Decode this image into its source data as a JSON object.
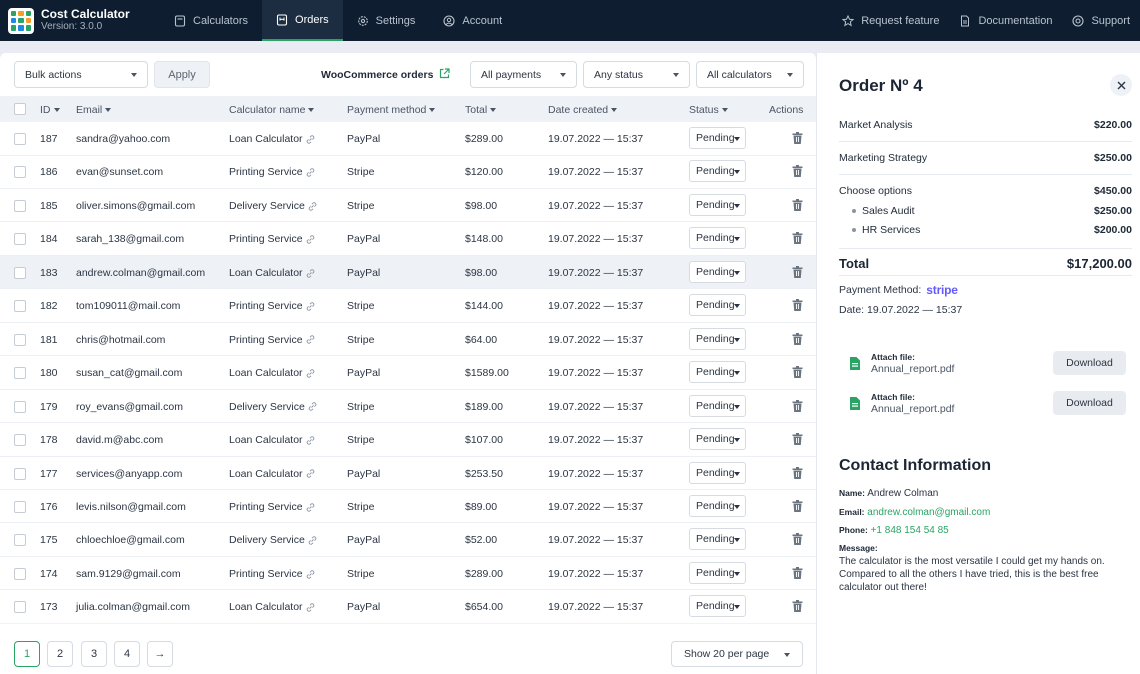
{
  "app": {
    "title": "Cost Calculator",
    "version": "Version: 3.0.0"
  },
  "nav": {
    "items": [
      {
        "label": "Calculators",
        "icon": "calculator-icon"
      },
      {
        "label": "Orders",
        "icon": "orders-icon",
        "active": true
      },
      {
        "label": "Settings",
        "icon": "gear-icon"
      },
      {
        "label": "Account",
        "icon": "user-circle-icon"
      }
    ],
    "right": [
      {
        "label": "Request feature",
        "icon": "star-icon"
      },
      {
        "label": "Documentation",
        "icon": "document-icon"
      },
      {
        "label": "Support",
        "icon": "lifebuoy-icon"
      }
    ]
  },
  "toolbar": {
    "bulk_actions": "Bulk actions",
    "apply": "Apply",
    "woo_link": "WooCommerce orders",
    "payments_filter": "All payments",
    "status_filter": "Any status",
    "calculators_filter": "All calculators"
  },
  "table": {
    "headers": {
      "id": "ID",
      "email": "Email",
      "calculator": "Calculator name",
      "payment": "Payment method",
      "total": "Total",
      "date": "Date created",
      "status": "Status",
      "actions": "Actions"
    },
    "rows": [
      {
        "id": "187",
        "email": "sandra@yahoo.com",
        "calculator": "Loan Calculator",
        "payment": "PayPal",
        "total": "$289.00",
        "date": "19.07.2022 — 15:37",
        "status": "Pending"
      },
      {
        "id": "186",
        "email": "evan@sunset.com",
        "calculator": "Printing Service",
        "payment": "Stripe",
        "total": "$120.00",
        "date": "19.07.2022 — 15:37",
        "status": "Pending"
      },
      {
        "id": "185",
        "email": "oliver.simons@gmail.com",
        "calculator": "Delivery Service",
        "payment": "Stripe",
        "total": "$98.00",
        "date": "19.07.2022 — 15:37",
        "status": "Pending"
      },
      {
        "id": "184",
        "email": "sarah_138@gmail.com",
        "calculator": "Printing Service",
        "payment": "PayPal",
        "total": "$148.00",
        "date": "19.07.2022 — 15:37",
        "status": "Pending"
      },
      {
        "id": "183",
        "email": "andrew.colman@gmail.com",
        "calculator": "Loan Calculator",
        "payment": "PayPal",
        "total": "$98.00",
        "date": "19.07.2022 — 15:37",
        "status": "Pending"
      },
      {
        "id": "182",
        "email": "tom109011@mail.com",
        "calculator": "Printing Service",
        "payment": "Stripe",
        "total": "$144.00",
        "date": "19.07.2022 — 15:37",
        "status": "Pending"
      },
      {
        "id": "181",
        "email": "chris@hotmail.com",
        "calculator": "Printing Service",
        "payment": "Stripe",
        "total": "$64.00",
        "date": "19.07.2022 — 15:37",
        "status": "Pending"
      },
      {
        "id": "180",
        "email": "susan_cat@gmail.com",
        "calculator": "Loan Calculator",
        "payment": "PayPal",
        "total": "$1589.00",
        "date": "19.07.2022 — 15:37",
        "status": "Pending"
      },
      {
        "id": "179",
        "email": "roy_evans@gmail.com",
        "calculator": "Delivery Service",
        "payment": "Stripe",
        "total": "$189.00",
        "date": "19.07.2022 — 15:37",
        "status": "Pending"
      },
      {
        "id": "178",
        "email": "david.m@abc.com",
        "calculator": "Loan Calculator",
        "payment": "Stripe",
        "total": "$107.00",
        "date": "19.07.2022 — 15:37",
        "status": "Pending"
      },
      {
        "id": "177",
        "email": "services@anyapp.com",
        "calculator": "Loan Calculator",
        "payment": "PayPal",
        "total": "$253.50",
        "date": "19.07.2022 — 15:37",
        "status": "Pending"
      },
      {
        "id": "176",
        "email": "levis.nilson@gmail.com",
        "calculator": "Printing Service",
        "payment": "Stripe",
        "total": "$89.00",
        "date": "19.07.2022 — 15:37",
        "status": "Pending"
      },
      {
        "id": "175",
        "email": "chloechloe@gmail.com",
        "calculator": "Delivery Service",
        "payment": "PayPal",
        "total": "$52.00",
        "date": "19.07.2022 — 15:37",
        "status": "Pending"
      },
      {
        "id": "174",
        "email": "sam.9129@gmail.com",
        "calculator": "Printing Service",
        "payment": "Stripe",
        "total": "$289.00",
        "date": "19.07.2022 — 15:37",
        "status": "Pending"
      },
      {
        "id": "173",
        "email": "julia.colman@gmail.com",
        "calculator": "Loan Calculator",
        "payment": "PayPal",
        "total": "$654.00",
        "date": "19.07.2022 — 15:37",
        "status": "Pending"
      }
    ]
  },
  "pagination": {
    "pages": [
      "1",
      "2",
      "3",
      "4"
    ],
    "next": "→",
    "per_page": "Show 20 per page"
  },
  "order": {
    "title": "Order Nº 4",
    "lines": [
      {
        "label": "Market Analysis",
        "value": "$220.00"
      },
      {
        "label": "Marketing Strategy",
        "value": "$250.00"
      },
      {
        "label": "Choose options",
        "value": "$450.00"
      }
    ],
    "sub_lines": [
      {
        "label": "Sales Audit",
        "value": "$250.00"
      },
      {
        "label": "HR Services",
        "value": "$200.00"
      }
    ],
    "total_label": "Total",
    "total_value": "$17,200.00",
    "payment_label": "Payment Method:",
    "payment_brand": "stripe",
    "date": "Date: 19.07.2022 — 15:37",
    "files": [
      {
        "label": "Attach file:",
        "name": "Annual_report.pdf",
        "button": "Download"
      },
      {
        "label": "Attach file:",
        "name": "Annual_report.pdf",
        "button": "Download"
      }
    ]
  },
  "contact": {
    "title": "Contact Information",
    "name_label": "Name:",
    "name": "Andrew Colman",
    "email_label": "Email:",
    "email": "andrew.colman@gmail.com",
    "phone_label": "Phone:",
    "phone": "+1 848 154 54 85",
    "message_label": "Message:",
    "message": "The calculator is the most versatile I could get my hands on. Compared to all the others I have tried, this is the best free calculator out there!"
  },
  "colors": {
    "accent": "#2aa465",
    "topbar": "#0e1d2f",
    "stripe": "#635bff"
  }
}
